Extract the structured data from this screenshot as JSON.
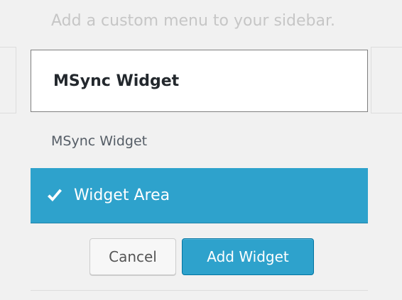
{
  "sidebar_hint": "Add a custom menu to your sidebar.",
  "widget": {
    "title": "MSync Widget",
    "subtitle": "MSync Widget"
  },
  "widget_area": {
    "label": "Widget Area",
    "selected": true,
    "icon": "checkmark-icon"
  },
  "buttons": {
    "cancel_label": "Cancel",
    "add_label": "Add Widget"
  },
  "colors": {
    "accent": "#2ea2cc",
    "accent_border": "#0074a2",
    "background": "#f1f1f1"
  }
}
